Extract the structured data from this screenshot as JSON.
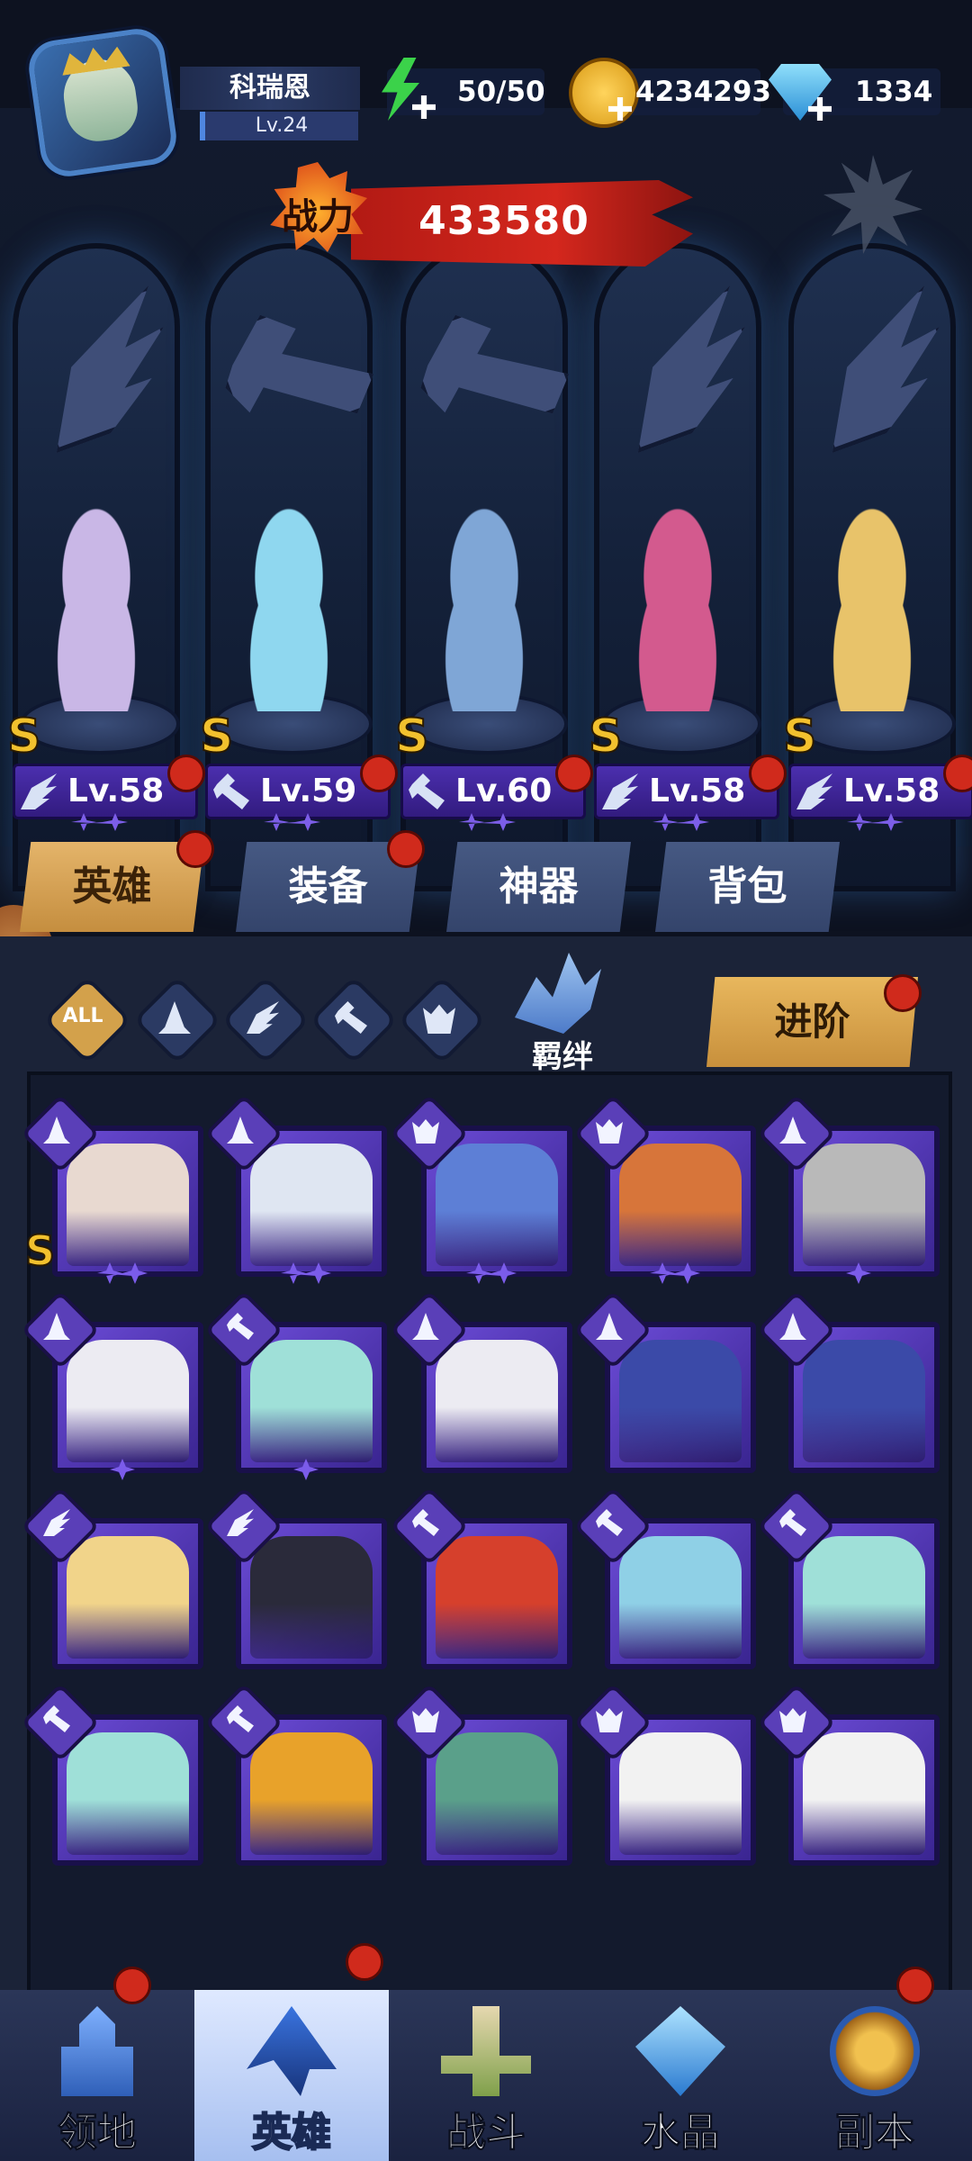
{
  "player": {
    "name": "科瑞恩",
    "level": "Lv.24"
  },
  "resources": {
    "energy": "50/50",
    "gold": "4234293",
    "diamonds": "1334"
  },
  "power": {
    "badge": "战力",
    "value": "433580"
  },
  "lineup": [
    {
      "rank": "S",
      "level": "Lv.58",
      "class": "wing-icon",
      "slot": "wing-slot-icon",
      "color": "#c9b7e6"
    },
    {
      "rank": "S",
      "level": "Lv.59",
      "class": "wrench-icon",
      "slot": "wrench-slot-icon",
      "color": "#8fd7ef"
    },
    {
      "rank": "S",
      "level": "Lv.60",
      "class": "wrench-icon",
      "slot": "wrench-slot-icon",
      "color": "#7fa6d6"
    },
    {
      "rank": "S",
      "level": "Lv.58",
      "class": "wing-icon",
      "slot": "wing-slot-icon",
      "color": "#d35a8e"
    },
    {
      "rank": "S",
      "level": "Lv.58",
      "class": "wing-icon",
      "slot": "wing-slot-icon",
      "color": "#e8c36a"
    }
  ],
  "tabs": [
    "英雄",
    "装备",
    "神器",
    "背包"
  ],
  "filters": {
    "all": "ALL"
  },
  "bond": "羁绊",
  "advance": "进阶",
  "grid": [
    {
      "class": "mage-icon",
      "color": "#e8d9d0",
      "stars": 2,
      "rank": "S"
    },
    {
      "class": "mage-icon",
      "color": "#dfe6f2",
      "stars": 2
    },
    {
      "class": "beast-icon",
      "color": "#5d7fd6",
      "stars": 2
    },
    {
      "class": "beast-icon",
      "color": "#d7753a",
      "stars": 2
    },
    {
      "class": "mage-icon",
      "color": "#b9b9b9",
      "stars": 1
    },
    {
      "class": "mage-icon",
      "color": "#ecebf2",
      "stars": 1
    },
    {
      "class": "wrench-icon",
      "color": "#9fe0d8",
      "stars": 1
    },
    {
      "class": "mage-icon",
      "color": "#ecebf2",
      "stars": 0
    },
    {
      "class": "mage-icon",
      "color": "#3b4aa8",
      "stars": 0
    },
    {
      "class": "mage-icon",
      "color": "#3b4aa8",
      "stars": 0
    },
    {
      "class": "wing-icon",
      "color": "#f1d48a",
      "stars": 0
    },
    {
      "class": "wing-icon",
      "color": "#2a2a3a",
      "stars": 0
    },
    {
      "class": "wrench-icon",
      "color": "#d6402c",
      "stars": 0
    },
    {
      "class": "wrench-icon",
      "color": "#8fd0e6",
      "stars": 0
    },
    {
      "class": "wrench-icon",
      "color": "#9fe0d8",
      "stars": 0
    },
    {
      "class": "wrench-icon",
      "color": "#9fe0d8",
      "stars": 0
    },
    {
      "class": "wrench-icon",
      "color": "#e8a22a",
      "stars": 0
    },
    {
      "class": "beast-icon",
      "color": "#5aa08a",
      "stars": 0
    },
    {
      "class": "beast-icon",
      "color": "#f2f2f2",
      "stars": 0
    },
    {
      "class": "beast-icon",
      "color": "#f2f2f2",
      "stars": 0
    }
  ],
  "nav": [
    "领地",
    "英雄",
    "战斗",
    "水晶",
    "副本"
  ],
  "colors": {
    "accent": "#d3a14b",
    "card": "#5a3fb8",
    "red_dot": "#d02a1c"
  }
}
